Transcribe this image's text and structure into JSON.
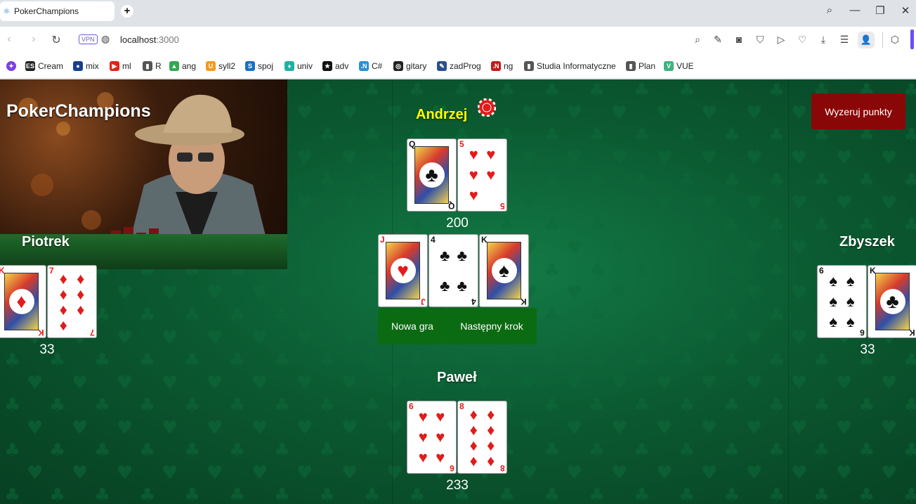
{
  "browser": {
    "tab_title": "PokerChampions",
    "vpn_label": "VPN",
    "url_host": "localhost",
    "url_port": ":3000"
  },
  "bookmarks": [
    {
      "label": "Cream",
      "badge": "ES",
      "color": "#222222"
    },
    {
      "label": "mix",
      "badge": "●",
      "color": "#1a3d8f"
    },
    {
      "label": "ml",
      "badge": "▶",
      "color": "#e62117"
    },
    {
      "label": "R",
      "badge": "▮",
      "color": "#555555"
    },
    {
      "label": "ang",
      "badge": "▲",
      "color": "#34a853"
    },
    {
      "label": "syll2",
      "badge": "U",
      "color": "#f49b1d"
    },
    {
      "label": "spoj",
      "badge": "S",
      "color": "#1a6fc4"
    },
    {
      "label": "univ",
      "badge": "♦",
      "color": "#1bb3a3"
    },
    {
      "label": "adv",
      "badge": "★",
      "color": "#111111"
    },
    {
      "label": "C#",
      "badge": ".N",
      "color": "#2a8fd6"
    },
    {
      "label": "gitary",
      "badge": "◎",
      "color": "#222222"
    },
    {
      "label": "zadProg",
      "badge": "✎",
      "color": "#2a4f8f"
    },
    {
      "label": "ng",
      "badge": ".N",
      "color": "#c51a1a"
    },
    {
      "label": "Studia Informatyczne",
      "badge": "▮",
      "color": "#555555"
    },
    {
      "label": "Plan",
      "badge": "▮",
      "color": "#555555"
    },
    {
      "label": "VUE",
      "badge": "V",
      "color": "#3fb27f"
    }
  ],
  "app": {
    "brand": "PokerChampions",
    "reset_button": "Wyzeruj punkty",
    "new_game_button": "Nowa gra",
    "next_step_button": "Następny krok"
  },
  "players": {
    "top": {
      "name": "Andrzej",
      "score": "200",
      "active": true,
      "cards": [
        {
          "rank": "Q",
          "suit": "♣",
          "color": "black"
        },
        {
          "rank": "5",
          "suit": "♥",
          "color": "red"
        }
      ]
    },
    "left": {
      "name": "Piotrek",
      "score": "33",
      "cards": [
        {
          "rank": "K",
          "suit": "♦",
          "color": "red"
        },
        {
          "rank": "7",
          "suit": "♦",
          "color": "red"
        }
      ]
    },
    "right": {
      "name": "Zbyszek",
      "score": "33",
      "cards": [
        {
          "rank": "6",
          "suit": "♠",
          "color": "black"
        },
        {
          "rank": "K",
          "suit": "♣",
          "color": "black"
        }
      ]
    },
    "bottom": {
      "name": "Paweł",
      "score": "233",
      "cards": [
        {
          "rank": "6",
          "suit": "♥",
          "color": "red"
        },
        {
          "rank": "8",
          "suit": "♦",
          "color": "red"
        }
      ]
    }
  },
  "community_cards": [
    {
      "rank": "J",
      "suit": "♥",
      "color": "red"
    },
    {
      "rank": "4",
      "suit": "♣",
      "color": "black"
    },
    {
      "rank": "K",
      "suit": "♠",
      "color": "black"
    }
  ],
  "colors": {
    "felt": "#0b5a31",
    "active_player": "#ffff00",
    "reset_button": "#8a0707",
    "action_button": "#0b6b12"
  }
}
